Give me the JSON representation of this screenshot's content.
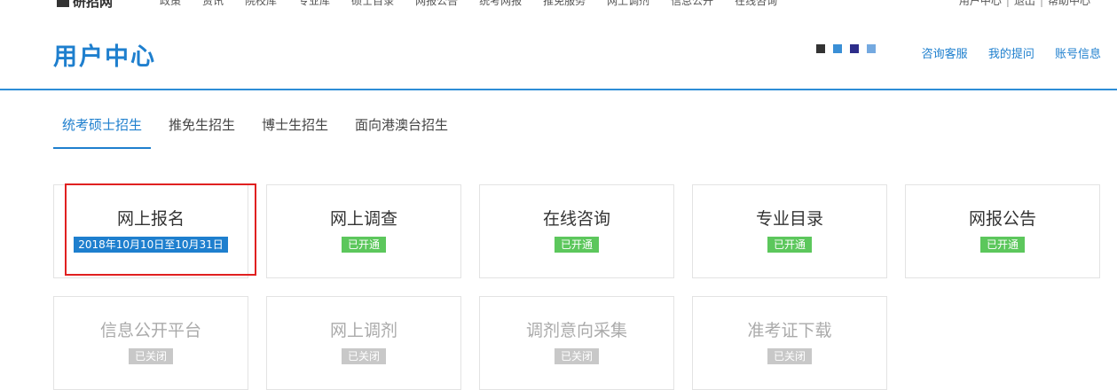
{
  "topbar": {
    "logo": "研招网",
    "nav": [
      "政策",
      "资讯",
      "院校库",
      "专业库",
      "硕士目录",
      "网报公告",
      "统考网报",
      "推免服务",
      "网上调剂",
      "信息公开",
      "在线咨询"
    ],
    "more": "•••",
    "right": [
      "用户中心",
      "退出",
      "帮助中心"
    ]
  },
  "header": {
    "title": "用户中心",
    "links": [
      "咨询客服",
      "我的提问",
      "账号信息"
    ],
    "dot_colors": [
      "#333333",
      "#3a8fd6",
      "#2d2d8a",
      "#74a9e0"
    ]
  },
  "tabs": [
    {
      "label": "统考硕士招生",
      "active": true
    },
    {
      "label": "推免生招生",
      "active": false
    },
    {
      "label": "博士生招生",
      "active": false
    },
    {
      "label": "面向港澳台招生",
      "active": false
    }
  ],
  "cards": [
    {
      "name": "网上报名",
      "status": "2018年10月10日至10月31日",
      "state": "date"
    },
    {
      "name": "网上调查",
      "status": "已开通",
      "state": "open"
    },
    {
      "name": "在线咨询",
      "status": "已开通",
      "state": "open"
    },
    {
      "name": "专业目录",
      "status": "已开通",
      "state": "open"
    },
    {
      "name": "网报公告",
      "status": "已开通",
      "state": "open"
    },
    {
      "name": "信息公开平台",
      "status": "已关闭",
      "state": "closed"
    },
    {
      "name": "网上调剂",
      "status": "已关闭",
      "state": "closed"
    },
    {
      "name": "调剂意向采集",
      "status": "已关闭",
      "state": "closed"
    },
    {
      "name": "准考证下载",
      "status": "已关闭",
      "state": "closed"
    }
  ]
}
